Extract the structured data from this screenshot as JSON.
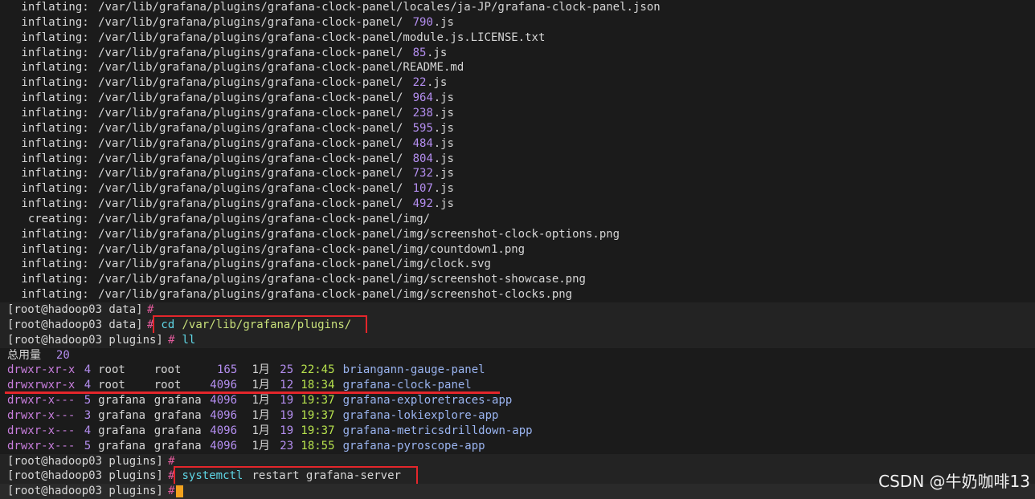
{
  "terminal": {
    "inflate_lines": [
      {
        "verb": "inflating:",
        "prefix": "/var/lib/grafana/plugins/grafana-clock-panel/locales/ja-JP/grafana-clock-panel.json",
        "num": "",
        "suffix": ""
      },
      {
        "verb": "inflating:",
        "prefix": "/var/lib/grafana/plugins/grafana-clock-panel/",
        "num": "790",
        "suffix": ".js"
      },
      {
        "verb": "inflating:",
        "prefix": "/var/lib/grafana/plugins/grafana-clock-panel/module.js.LICENSE.txt",
        "num": "",
        "suffix": ""
      },
      {
        "verb": "inflating:",
        "prefix": "/var/lib/grafana/plugins/grafana-clock-panel/",
        "num": "85",
        "suffix": ".js"
      },
      {
        "verb": "inflating:",
        "prefix": "/var/lib/grafana/plugins/grafana-clock-panel/README.md",
        "num": "",
        "suffix": ""
      },
      {
        "verb": "inflating:",
        "prefix": "/var/lib/grafana/plugins/grafana-clock-panel/",
        "num": "22",
        "suffix": ".js"
      },
      {
        "verb": "inflating:",
        "prefix": "/var/lib/grafana/plugins/grafana-clock-panel/",
        "num": "964",
        "suffix": ".js"
      },
      {
        "verb": "inflating:",
        "prefix": "/var/lib/grafana/plugins/grafana-clock-panel/",
        "num": "238",
        "suffix": ".js"
      },
      {
        "verb": "inflating:",
        "prefix": "/var/lib/grafana/plugins/grafana-clock-panel/",
        "num": "595",
        "suffix": ".js"
      },
      {
        "verb": "inflating:",
        "prefix": "/var/lib/grafana/plugins/grafana-clock-panel/",
        "num": "484",
        "suffix": ".js"
      },
      {
        "verb": "inflating:",
        "prefix": "/var/lib/grafana/plugins/grafana-clock-panel/",
        "num": "804",
        "suffix": ".js"
      },
      {
        "verb": "inflating:",
        "prefix": "/var/lib/grafana/plugins/grafana-clock-panel/",
        "num": "732",
        "suffix": ".js"
      },
      {
        "verb": "inflating:",
        "prefix": "/var/lib/grafana/plugins/grafana-clock-panel/",
        "num": "107",
        "suffix": ".js"
      },
      {
        "verb": "inflating:",
        "prefix": "/var/lib/grafana/plugins/grafana-clock-panel/",
        "num": "492",
        "suffix": ".js"
      },
      {
        "verb": " creating:",
        "prefix": "/var/lib/grafana/plugins/grafana-clock-panel/img/",
        "num": "",
        "suffix": ""
      },
      {
        "verb": "inflating:",
        "prefix": "/var/lib/grafana/plugins/grafana-clock-panel/img/screenshot-clock-options.png",
        "num": "",
        "suffix": ""
      },
      {
        "verb": "inflating:",
        "prefix": "/var/lib/grafana/plugins/grafana-clock-panel/img/countdown1.png",
        "num": "",
        "suffix": ""
      },
      {
        "verb": "inflating:",
        "prefix": "/var/lib/grafana/plugins/grafana-clock-panel/img/clock.svg",
        "num": "",
        "suffix": ""
      },
      {
        "verb": "inflating:",
        "prefix": "/var/lib/grafana/plugins/grafana-clock-panel/img/screenshot-showcase.png",
        "num": "",
        "suffix": ""
      },
      {
        "verb": "inflating:",
        "prefix": "/var/lib/grafana/plugins/grafana-clock-panel/img/screenshot-clocks.png",
        "num": "",
        "suffix": ""
      }
    ],
    "prompt_data": "[root@hadoop03 data]",
    "prompt_plugins": "[root@hadoop03 plugins]",
    "hash": "#",
    "cmd_cd": "cd",
    "cmd_cd_arg": "/var/lib/grafana/plugins/",
    "cmd_ll": "ll",
    "total_label": "总用量",
    "total_value": "20",
    "listing": [
      {
        "perm": "drwxr-xr-x",
        "links": "4",
        "owner": "root",
        "group": "root",
        "size": "165",
        "month": "1月",
        "day": "25",
        "time": "22:45",
        "name": "briangann-gauge-panel"
      },
      {
        "perm": "drwxrwxr-x",
        "links": "4",
        "owner": "root",
        "group": "root",
        "size": "4096",
        "month": "1月",
        "day": "12",
        "time": "18:34",
        "name": "grafana-clock-panel"
      },
      {
        "perm": "drwxr-x---",
        "links": "5",
        "owner": "grafana",
        "group": "grafana",
        "size": "4096",
        "month": "1月",
        "day": "19",
        "time": "19:37",
        "name": "grafana-exploretraces-app"
      },
      {
        "perm": "drwxr-x---",
        "links": "3",
        "owner": "grafana",
        "group": "grafana",
        "size": "4096",
        "month": "1月",
        "day": "19",
        "time": "19:37",
        "name": "grafana-lokiexplore-app"
      },
      {
        "perm": "drwxr-x---",
        "links": "4",
        "owner": "grafana",
        "group": "grafana",
        "size": "4096",
        "month": "1月",
        "day": "19",
        "time": "19:37",
        "name": "grafana-metricsdrilldown-app"
      },
      {
        "perm": "drwxr-x---",
        "links": "5",
        "owner": "grafana",
        "group": "grafana",
        "size": "4096",
        "month": "1月",
        "day": "23",
        "time": "18:55",
        "name": "grafana-pyroscope-app"
      }
    ],
    "cmd_systemctl": "systemctl",
    "cmd_systemctl_args": "restart grafana-server"
  },
  "watermark": "CSDN @牛奶咖啡13",
  "colors": {
    "background": "#1b1b1b",
    "annotation_red": "#e3262b",
    "cursor": "#f3a21e"
  }
}
